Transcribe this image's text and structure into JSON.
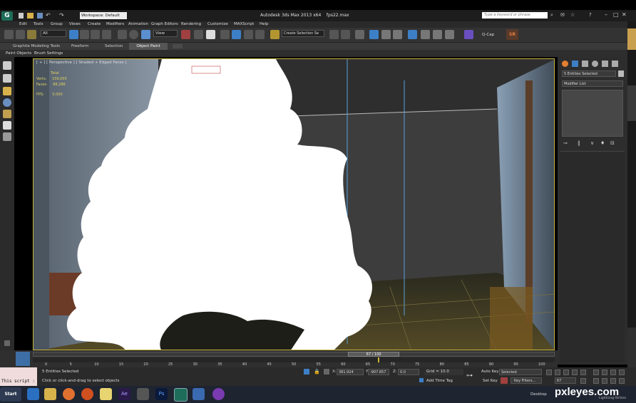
{
  "title_bar": {
    "workspace_label": "Workspace: Default",
    "app_title": "Autodesk 3ds Max 2013 x64",
    "file_name": "fps22.max",
    "search_placeholder": "Type a keyword or phrase"
  },
  "menu": {
    "items": [
      "Edit",
      "Tools",
      "Group",
      "Views",
      "Create",
      "Modifiers",
      "Animation",
      "Graph Editors",
      "Rendering",
      "Customize",
      "MAXScript",
      "Help"
    ]
  },
  "toolbar": {
    "selection_filter": "All",
    "reference_coord": "View",
    "named_selection_placeholder": "Create Selection Se",
    "qcap_label": "Q-Cap",
    "sr_label": "SR"
  },
  "ribbon": {
    "tabs": [
      "Graphite Modeling Tools",
      "Freeform",
      "Selection",
      "Object Paint"
    ],
    "active_tab": "Object Paint",
    "sub_tabs": [
      "Paint Objects",
      "Brush Settings"
    ]
  },
  "viewport": {
    "label": "[ + ] [ Perspective ] [ Shaded + Edged Faces ]",
    "stats_total": "Total",
    "stats_verts_label": "Verts:",
    "stats_verts": "159,003",
    "stats_faces_label": "Faces:",
    "stats_faces": "88,286",
    "fps_label": "FPS:",
    "fps_value": "0.000"
  },
  "command_panel": {
    "selection_name": "5 Entities Selected",
    "modifier_list": "Modifier List"
  },
  "timeline": {
    "frame_counter": "67 / 100",
    "current_fraction": 0.67,
    "ticks": [
      "0",
      "5",
      "10",
      "15",
      "20",
      "25",
      "30",
      "35",
      "40",
      "45",
      "50",
      "55",
      "60",
      "65",
      "70",
      "75",
      "80",
      "85",
      "90",
      "95",
      "100"
    ]
  },
  "status": {
    "listener_text": "This script :",
    "selection_count": "5 Entities Selected",
    "prompt": "Click or click-and-drag to select objects",
    "x_label": "X:",
    "x_value": "381.924",
    "y_label": "Y:",
    "y_value": "-907.857",
    "z_label": "Z:",
    "z_value": "0.0",
    "grid_label": "Grid = 10.0",
    "add_time_tag": "Add Time Tag",
    "auto_key": "Auto Key",
    "auto_key_mode": "Selected",
    "set_key": "Set Key",
    "key_filters": "Key Filters...",
    "current_frame": "67"
  },
  "taskbar": {
    "start_label": "Start",
    "desktop_label": "Desktop",
    "watermark": "pxleyes.com",
    "watermark_sub": "Lightning-Strikes"
  },
  "colors": {
    "viewport_border": "#c8b43a",
    "smoke": "#ffffff",
    "accent_blue": "#3d7fc6"
  }
}
